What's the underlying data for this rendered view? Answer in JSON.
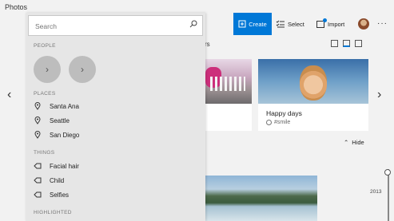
{
  "window": {
    "title": "Photos"
  },
  "toolbar": {
    "create_label": "Create",
    "select_label": "Select",
    "import_label": "Import",
    "more_label": "···"
  },
  "search": {
    "placeholder": "Search",
    "value": ""
  },
  "panel": {
    "people_header": "PEOPLE",
    "places_header": "PLACES",
    "places": [
      "Santa Ana",
      "Seattle",
      "San Diego"
    ],
    "things_header": "THINGS",
    "things": [
      "Facial hair",
      "Child",
      "Selfies"
    ],
    "highlighted_header": "HIGHLIGHTED"
  },
  "main": {
    "section_partial": "rs",
    "card": {
      "caption": "Happy days",
      "tag": "#smile"
    },
    "hide_label": "Hide",
    "timeline_year": "2013"
  },
  "colors": {
    "accent": "#0078d7",
    "panel": "#e6e6e6",
    "background": "#f2f2f2"
  },
  "icons": {
    "nav_prev": "chevron-left-icon",
    "nav_next": "chevron-right-icon",
    "place": "map-pin-icon",
    "thing": "tag-icon",
    "search": "search-icon"
  }
}
